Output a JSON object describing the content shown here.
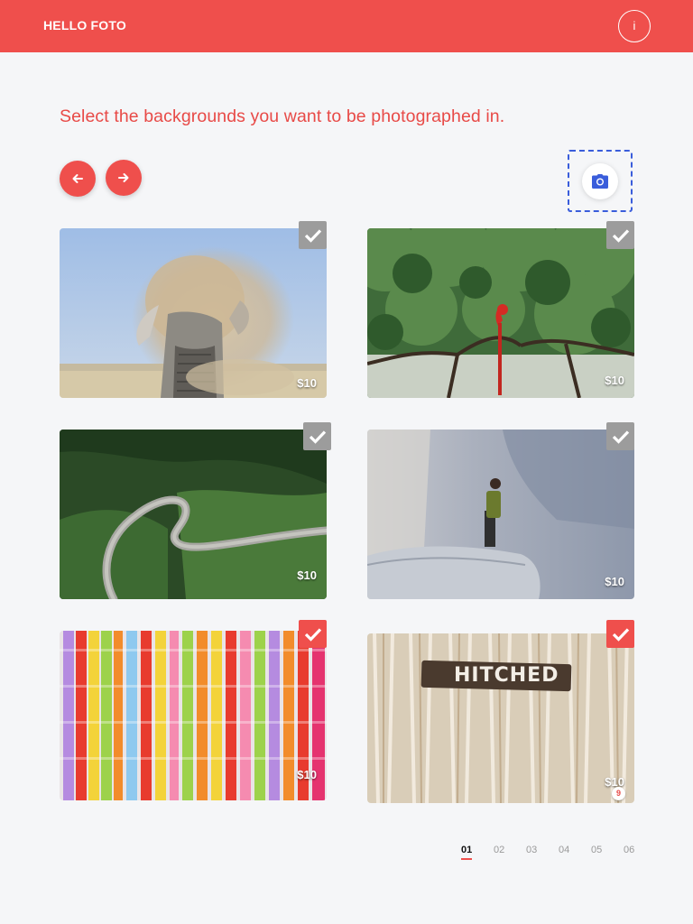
{
  "header": {
    "brand": "HELLO FOTO",
    "info_label": "i"
  },
  "main": {
    "heading": "Select the backgrounds you want to be photographed in."
  },
  "icons": {
    "prev": "arrow-left-icon",
    "next": "arrow-right-icon",
    "camera": "camera-icon",
    "check": "checkmark-icon"
  },
  "colors": {
    "accent": "#ef4f4c",
    "heading_text": "#e84a47",
    "camera_icon": "#3a5ddb",
    "check_unselected": "#9c9c9c",
    "background": "#f5f6f8"
  },
  "backgrounds": [
    {
      "scene": "elephant-dust",
      "price": "$10",
      "selected": false
    },
    {
      "scene": "parrot-tree",
      "price": "$10",
      "selected": false
    },
    {
      "scene": "winding-road",
      "price": "$10",
      "selected": false
    },
    {
      "scene": "cliff-hiker",
      "price": "$10",
      "selected": false
    },
    {
      "scene": "crepe-streamers",
      "price": "$10",
      "selected": true
    },
    {
      "scene": "hitched-sign",
      "price": "$10",
      "selected": true,
      "sign_text": "HITCHED",
      "badge": "9"
    }
  ],
  "pagination": {
    "pages": [
      "01",
      "02",
      "03",
      "04",
      "05",
      "06"
    ],
    "current": "01"
  }
}
